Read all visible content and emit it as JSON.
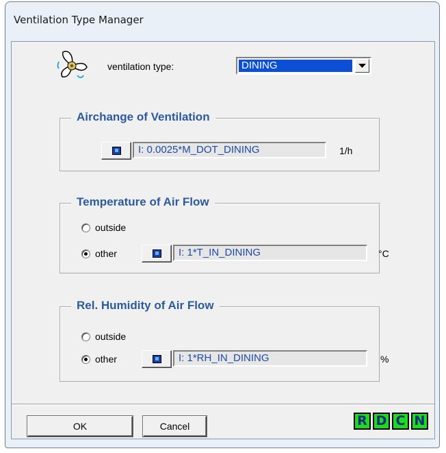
{
  "window": {
    "title": "Ventilation Type Manager"
  },
  "ventilation_type": {
    "label": "ventilation type:",
    "selected": "DINING",
    "icon": "fan-icon"
  },
  "airchange": {
    "title": "Airchange of Ventilation",
    "value": "I: 0.0025*M_DOT_DINING",
    "unit": "1/h"
  },
  "temperature": {
    "title": "Temperature of Air Flow",
    "options": [
      {
        "label": "outside",
        "selected": false
      },
      {
        "label": "other",
        "selected": true
      }
    ],
    "value": "I: 1*T_IN_DINING",
    "unit": "°C"
  },
  "humidity": {
    "title": "Rel. Humidity of Air Flow",
    "options": [
      {
        "label": "outside",
        "selected": false
      },
      {
        "label": "other",
        "selected": true
      }
    ],
    "value": "I: 1*RH_IN_DINING",
    "unit": "%"
  },
  "footer": {
    "ok_label": "OK",
    "cancel_label": "Cancel",
    "tool_buttons": [
      "R",
      "D",
      "C",
      "N"
    ]
  },
  "colors": {
    "selection": "#0a4fd6",
    "group_title": "#2c5aa0",
    "tool_button": "#1fd81f"
  }
}
